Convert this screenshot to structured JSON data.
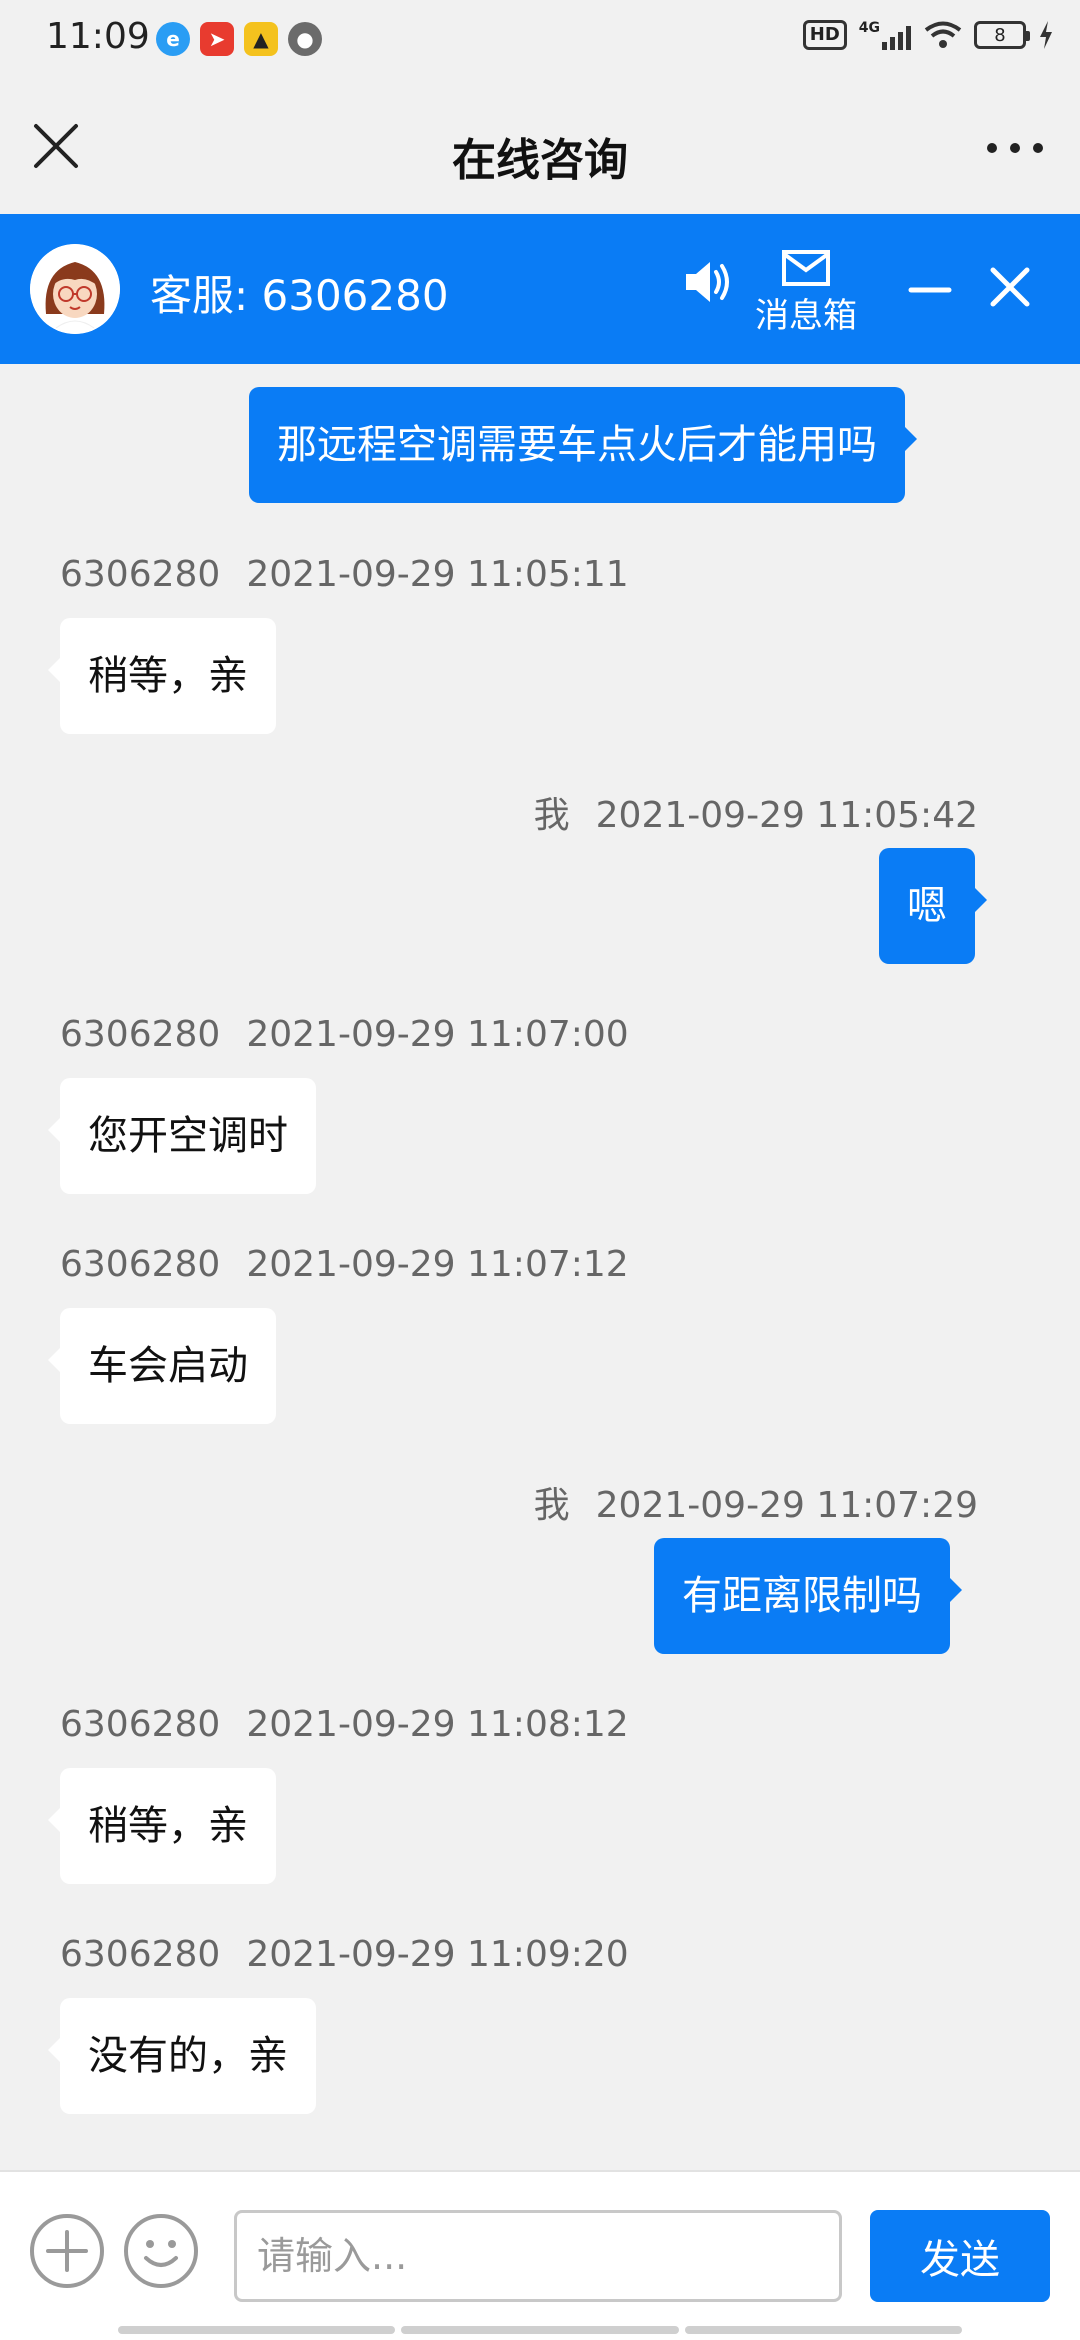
{
  "status_bar": {
    "time": "11:09",
    "apps": [
      "browser-icon",
      "maps-icon",
      "car-app-icon",
      "wechat-icon"
    ],
    "hd": "HD",
    "network": "4G",
    "battery": "8"
  },
  "title_bar": {
    "title": "在线咨询"
  },
  "agent_bar": {
    "name": "客服: 6306280",
    "inbox_label": "消息箱",
    "accent": "#0a7cf5"
  },
  "messages": [
    {
      "side": "right",
      "text": "那远程空调需要车点火后才能用吗"
    },
    {
      "side": "left",
      "sender": "6306280",
      "time": "2021-09-29 11:05:11",
      "text": "稍等，亲"
    },
    {
      "side": "right",
      "sender": "我",
      "time": "2021-09-29 11:05:42",
      "text": "嗯"
    },
    {
      "side": "left",
      "sender": "6306280",
      "time": "2021-09-29 11:07:00",
      "text": "您开空调时"
    },
    {
      "side": "left",
      "sender": "6306280",
      "time": "2021-09-29 11:07:12",
      "text": "车会启动"
    },
    {
      "side": "right",
      "sender": "我",
      "time": "2021-09-29 11:07:29",
      "text": "有距离限制吗"
    },
    {
      "side": "left",
      "sender": "6306280",
      "time": "2021-09-29 11:08:12",
      "text": "稍等，亲"
    },
    {
      "side": "left",
      "sender": "6306280",
      "time": "2021-09-29 11:09:20",
      "text": "没有的，亲"
    }
  ],
  "input_bar": {
    "placeholder": "请输入...",
    "send_label": "发送"
  }
}
